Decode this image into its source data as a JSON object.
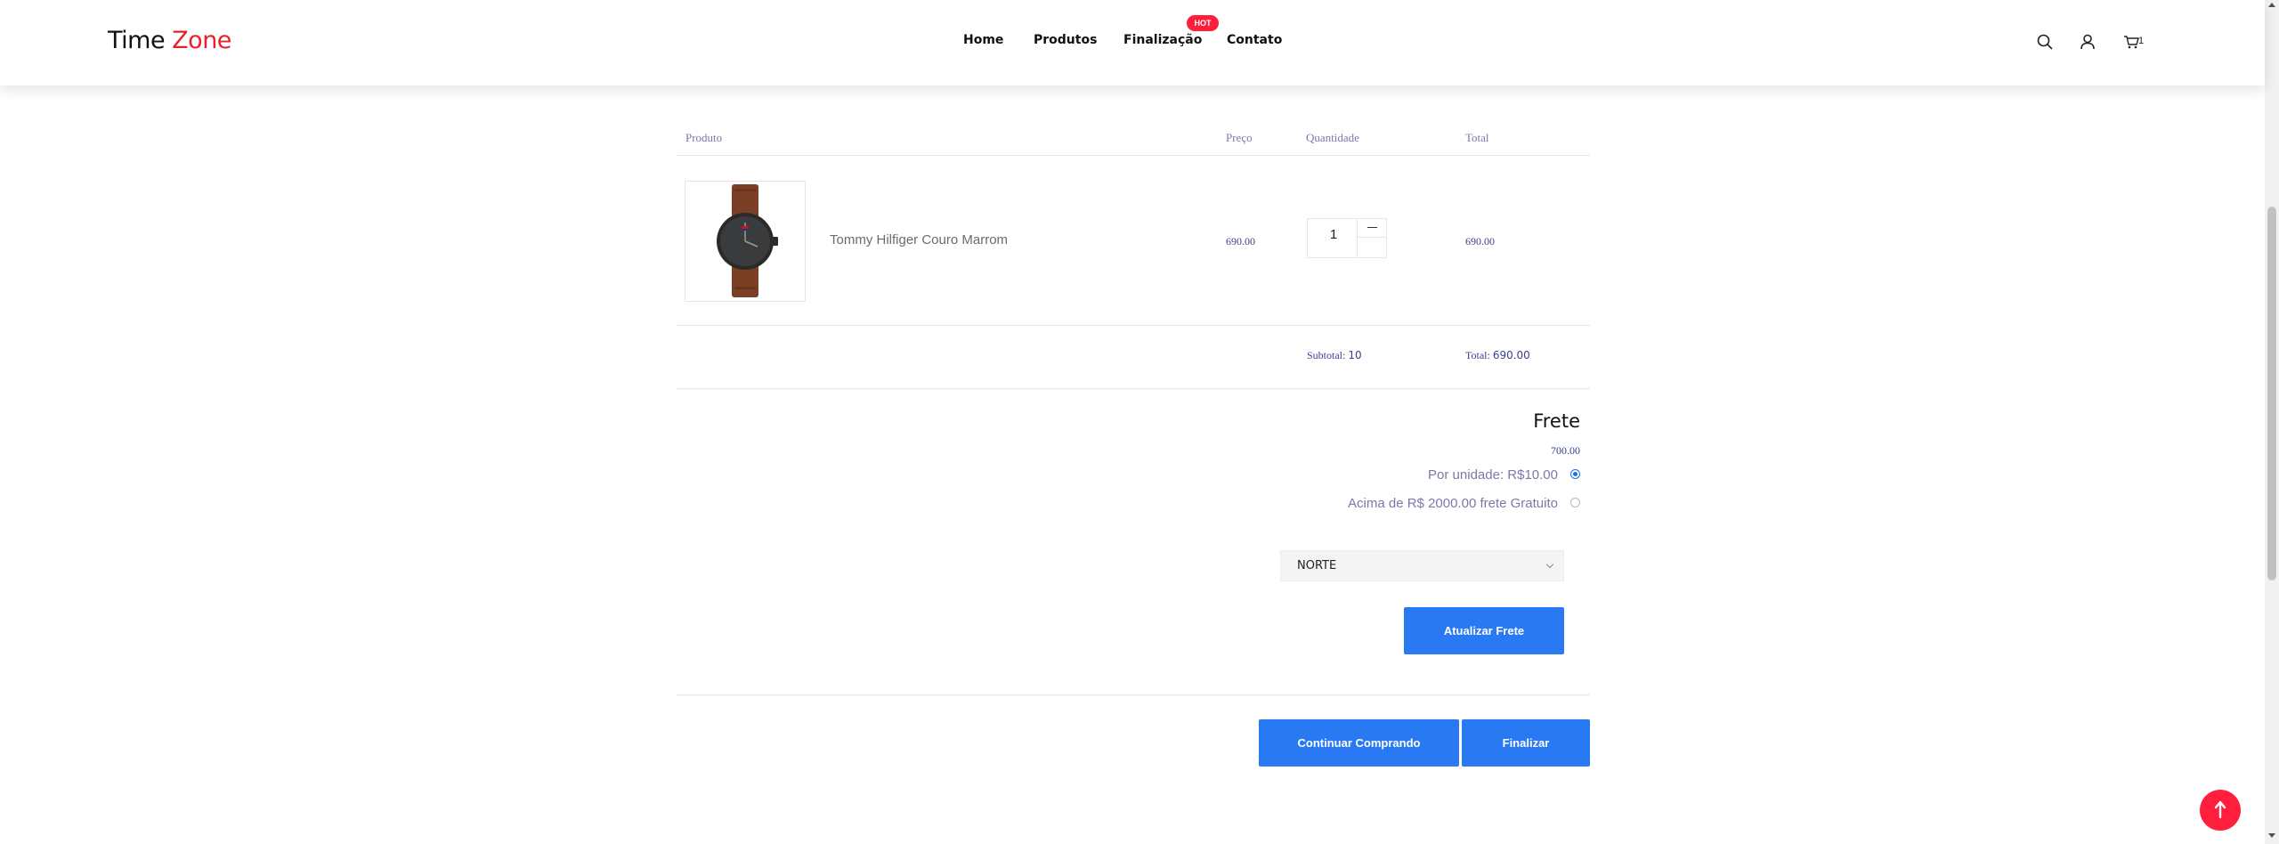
{
  "header": {
    "logo_part1": "Time ",
    "logo_part2": "Zone",
    "nav": [
      "Home",
      "Produtos",
      "Finalização",
      "Contato"
    ],
    "hot_badge": "HOT",
    "cart_count": "1",
    "icons": [
      "search-icon",
      "user-icon",
      "cart-icon"
    ]
  },
  "cart": {
    "columns": {
      "product": "Produto",
      "price": "Preço",
      "quantity": "Quantidade",
      "total": "Total"
    },
    "items": [
      {
        "name": "Tommy Hilfiger Couro Marrom",
        "price": "690.00",
        "quantity": "1",
        "total": "690.00",
        "image": "watch-brown-leather"
      }
    ],
    "subtotal_label": "Subtotal:",
    "subtotal_value": "10",
    "total_label": "Total:",
    "total_value": "690.00"
  },
  "shipping": {
    "title": "Frete",
    "value": "700.00",
    "options": [
      {
        "label": "Por unidade: R$10.00",
        "selected": true
      },
      {
        "label": "Acima de R$ 2000.00 frete Gratuito",
        "selected": false
      }
    ],
    "region_selected": "NORTE",
    "update_button": "Atualizar Frete"
  },
  "actions": {
    "continue_button": "Continuar Comprando",
    "checkout_button": "Finalizar"
  },
  "colors": {
    "brand_red": "#e8202a",
    "primary_blue": "#2979f2",
    "money_blue": "#3a3f8f"
  }
}
